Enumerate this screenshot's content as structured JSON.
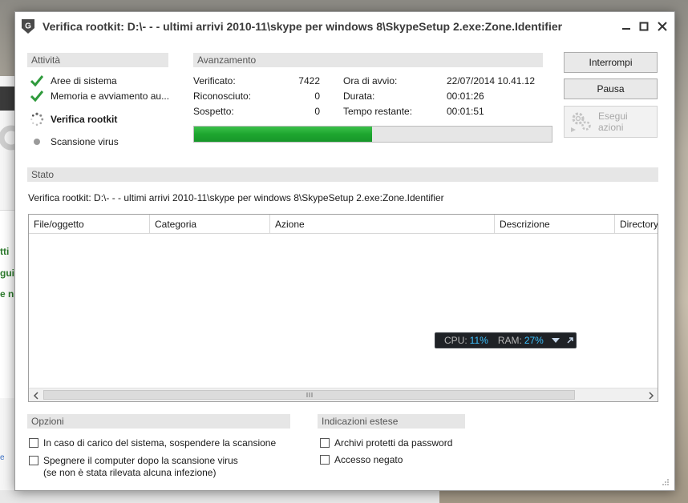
{
  "background": {
    "side_fragments": [
      "tti",
      "gui",
      "e n"
    ]
  },
  "window": {
    "title": "Verifica rootkit: D:\\- - - ultimi arrivi 2010-11\\skype per windows 8\\SkypeSetup 2.exe:Zone.Identifier",
    "controls": {
      "minimize": "minimize-icon",
      "maximize": "maximize-icon",
      "close": "close-icon"
    }
  },
  "activities": {
    "header": "Attività",
    "items": [
      {
        "label": "Aree di sistema",
        "icon": "check-icon",
        "state": "done"
      },
      {
        "label": "Memoria e avviamento au...",
        "icon": "check-icon",
        "state": "done"
      },
      {
        "label": "Verifica rootkit",
        "icon": "spinner-icon",
        "state": "running"
      },
      {
        "label": "Scansione virus",
        "icon": "dot-icon",
        "state": "pending"
      }
    ]
  },
  "progress": {
    "header": "Avanzamento",
    "checked_label": "Verificato:",
    "checked_value": "7422",
    "recognized_label": "Riconosciuto:",
    "recognized_value": "0",
    "suspect_label": "Sospetto:",
    "suspect_value": "0",
    "start_label": "Ora di avvio:",
    "start_value": "22/07/2014 10.41.12",
    "duration_label": "Durata:",
    "duration_value": "00:01:26",
    "remaining_label": "Tempo restante:",
    "remaining_value": "00:01:51",
    "fraction": 0.498
  },
  "buttons": {
    "stop": "Interrompi",
    "pause": "Pausa",
    "actions_line1": "Esegui",
    "actions_line2": "azioni"
  },
  "status": {
    "header": "Stato",
    "text": "Verifica rootkit: D:\\- - - ultimi arrivi 2010-11\\skype per windows 8\\SkypeSetup 2.exe:Zone.Identifier"
  },
  "table": {
    "columns": [
      "File/oggetto",
      "Categoria",
      "Azione",
      "Descrizione",
      "Directory"
    ],
    "rows": []
  },
  "system_monitor": {
    "cpu_label": "CPU:",
    "cpu_value": "11%",
    "ram_label": "RAM:",
    "ram_value": "27%"
  },
  "options": {
    "header": "Opzioni",
    "suspend_label": "In caso di carico del sistema, sospendere la scansione",
    "shutdown_label_1": "Spegnere il computer dopo la scansione virus",
    "shutdown_label_2": "(se non è stata rilevata alcuna infezione)"
  },
  "extended": {
    "header": "Indicazioni estese",
    "archives_label": "Archivi protetti da password",
    "access_label": "Accesso negato"
  },
  "colors": {
    "progress": "#1ea62f",
    "check": "#2f9a3c",
    "monitor_value": "#3cc1ff"
  }
}
